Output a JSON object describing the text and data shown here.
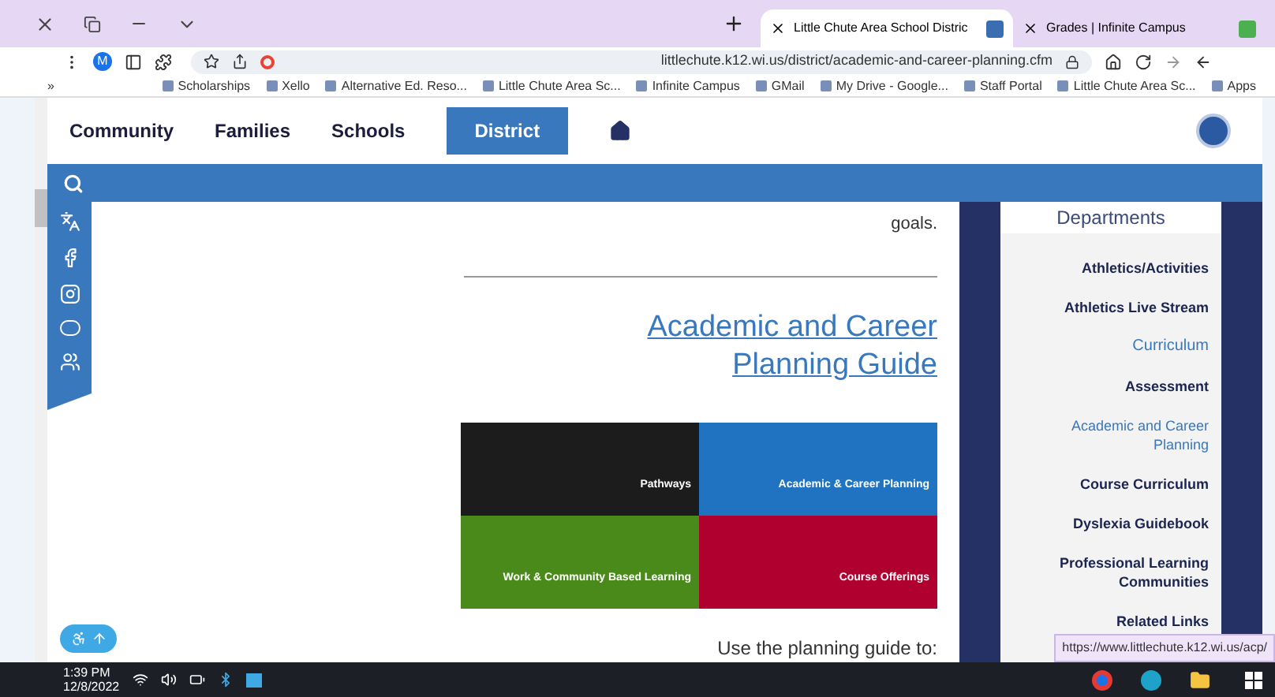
{
  "browser": {
    "tabs": [
      {
        "title": "Little Chute Area School Distric",
        "selected": true
      },
      {
        "title": "Grades | Infinite Campus",
        "selected": false
      }
    ],
    "address": "littlechute.k12.wi.us/district/academic-and-career-planning.cfm",
    "profile": "M",
    "bookmarks_more": "»",
    "bookmarks": [
      "Scholarships",
      "Xello",
      "Alternative Ed. Reso...",
      "Little Chute Area Sc...",
      "Infinite Campus",
      "GMail",
      "My Drive - Google...",
      "Staff Portal",
      "Little Chute Area Sc...",
      "Apps"
    ]
  },
  "site": {
    "nav": [
      {
        "label": "Community",
        "selected": false
      },
      {
        "label": "Families",
        "selected": false
      },
      {
        "label": "Schools",
        "selected": false
      },
      {
        "label": "District",
        "selected": true
      }
    ],
    "intro_tail": "goals.",
    "heading": "Academic and Career Planning Guide",
    "guide_tiles": [
      {
        "title": "Pathways",
        "color": "#1c1c1c"
      },
      {
        "title": "Academic & Career Planning",
        "color": "#1f73c0"
      },
      {
        "title": "Work & Community Based Learning",
        "color": "#4a8a1a"
      },
      {
        "title": "Course Offerings",
        "color": "#b0002f"
      }
    ],
    "list_intro": "Use the planning guide to:",
    "sidebar": {
      "title": "Departments",
      "items": [
        {
          "label": "Athletics/Activities",
          "kind": "link",
          "selected": false
        },
        {
          "label": "Athletics Live Stream",
          "kind": "link",
          "selected": false
        },
        {
          "label": "Curriculum",
          "kind": "section",
          "selected": true
        },
        {
          "label": "Assessment",
          "kind": "link",
          "selected": false
        },
        {
          "label": "Academic and Career Planning",
          "kind": "link",
          "selected": true
        },
        {
          "label": "Course Curriculum",
          "kind": "link",
          "selected": false
        },
        {
          "label": "Dyslexia Guidebook",
          "kind": "link",
          "selected": false
        },
        {
          "label": "Professional Learning Communities",
          "kind": "link",
          "selected": false
        },
        {
          "label": "Related Links",
          "kind": "link",
          "selected": false
        }
      ]
    }
  },
  "status_url": "https://www.littlechute.k12.wi.us/acp/",
  "taskbar": {
    "time": "1:39 PM",
    "date": "12/8/2022"
  }
}
